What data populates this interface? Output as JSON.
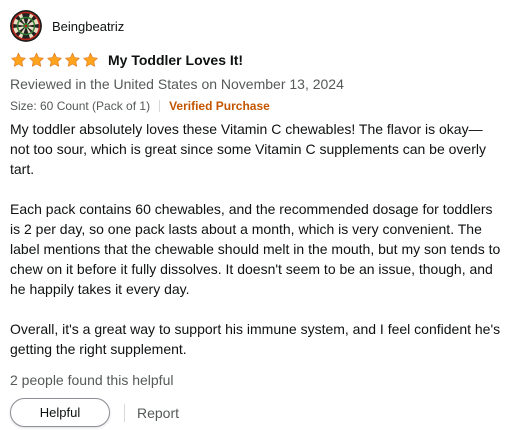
{
  "reviewer": {
    "name": "Beingbeatriz",
    "avatar_icon": "dartboard-avatar"
  },
  "rating": {
    "stars": 5,
    "max": 5,
    "star_color": "#ffa41c"
  },
  "review": {
    "title": "My Toddler Loves It!",
    "date": "Reviewed in the United States on November 13, 2024",
    "format": "Size: 60 Count (Pack of 1)",
    "verified": "Verified Purchase",
    "verified_color": "#c45500",
    "body": [
      "My toddler absolutely loves these Vitamin C chewables! The flavor is okay—not too sour, which is great since some Vitamin C supplements can be overly tart.",
      "Each pack contains 60 chewables, and the recommended dosage for toddlers is 2 per day, so one pack lasts about a month, which is very convenient. The label mentions that the chewable should melt in the mouth, but my son tends to chew on it before it fully dissolves. It doesn't seem to be an issue, though, and he happily takes it every day.",
      "Overall, it's a great way to support his immune system, and I feel confident he's getting the right supplement."
    ],
    "helpful_count": "2 people found this helpful"
  },
  "actions": {
    "helpful_label": "Helpful",
    "report_label": "Report"
  }
}
